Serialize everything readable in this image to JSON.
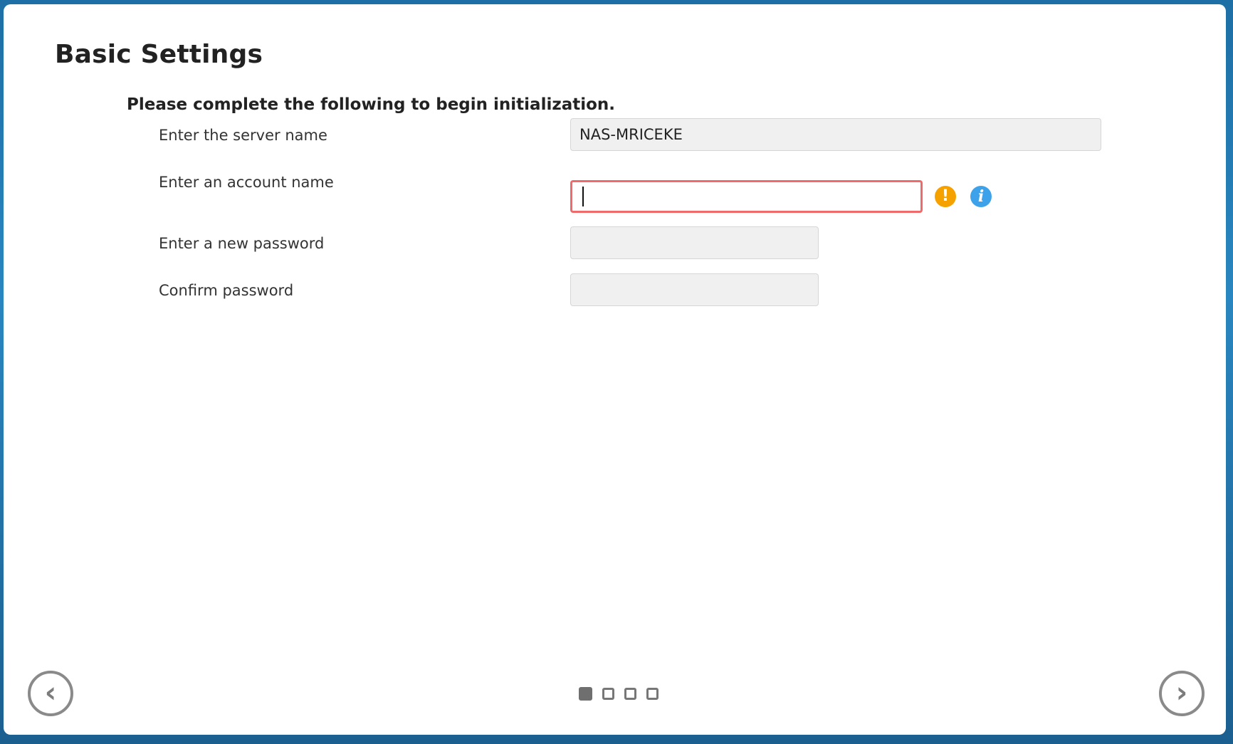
{
  "page": {
    "title": "Basic Settings",
    "instruction": "Please complete the following to begin initialization."
  },
  "form": {
    "server_name": {
      "label": "Enter the server name",
      "value": "NAS-MRICEKE"
    },
    "account_name": {
      "label": "Enter an account name",
      "value": "",
      "state": "error"
    },
    "new_password": {
      "label": "Enter a new password",
      "value": ""
    },
    "confirm_password": {
      "label": "Confirm password",
      "value": ""
    }
  },
  "icons": {
    "warning": {
      "name": "warning-icon",
      "glyph": "!",
      "color": "#f5a100"
    },
    "info": {
      "name": "info-icon",
      "glyph": "i",
      "color": "#3ea2ea"
    },
    "prev": {
      "name": "chevron-left-icon",
      "glyph": "‹"
    },
    "next": {
      "name": "chevron-right-icon",
      "glyph": "›"
    }
  },
  "pagination": {
    "total_steps": 4,
    "current_step": 1
  },
  "colors": {
    "error_border": "#ef6a6a",
    "field_background": "#f0f0f0"
  }
}
